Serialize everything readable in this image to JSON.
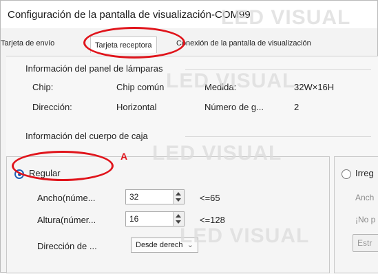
{
  "window": {
    "title": "Configuración de la pantalla de visualización-COM99"
  },
  "tabs": [
    {
      "label": "Tarjeta de envío",
      "active": false
    },
    {
      "label": "Tarjeta receptora",
      "active": true
    },
    {
      "label": "Conexión de la pantalla de visualización",
      "active": false
    }
  ],
  "panel_info": {
    "heading": "Información del panel de lámparas",
    "chip_label": "Chip:",
    "chip_value": "Chip común",
    "medida_label": "Medida:",
    "medida_value": "32W×16H",
    "direccion_label": "Dirección:",
    "direccion_value": "Horizontal",
    "numero_label": "Número de g...",
    "numero_value": "2"
  },
  "box_info": {
    "heading": "Información del cuerpo de caja"
  },
  "regular": {
    "label": "Regular",
    "selected": true,
    "ancho_label": "Ancho(núme...",
    "ancho_value": "32",
    "ancho_limit": "<=65",
    "altura_label": "Altura(númer...",
    "altura_value": "16",
    "altura_limit": "<=128",
    "direccion_label": "Dirección de ...",
    "direccion_value": "Desde derech"
  },
  "irregular": {
    "label": "Irreg",
    "selected": false,
    "ancho_label": "Anch",
    "note": "¡No p",
    "button_label": "Estr"
  },
  "annotation": {
    "letter": "A",
    "color": "#e0141b"
  },
  "watermark": {
    "text": "LED VISUAL"
  },
  "colors": {
    "accent": "#1f5fb4",
    "annotation_red": "#e0141b"
  }
}
